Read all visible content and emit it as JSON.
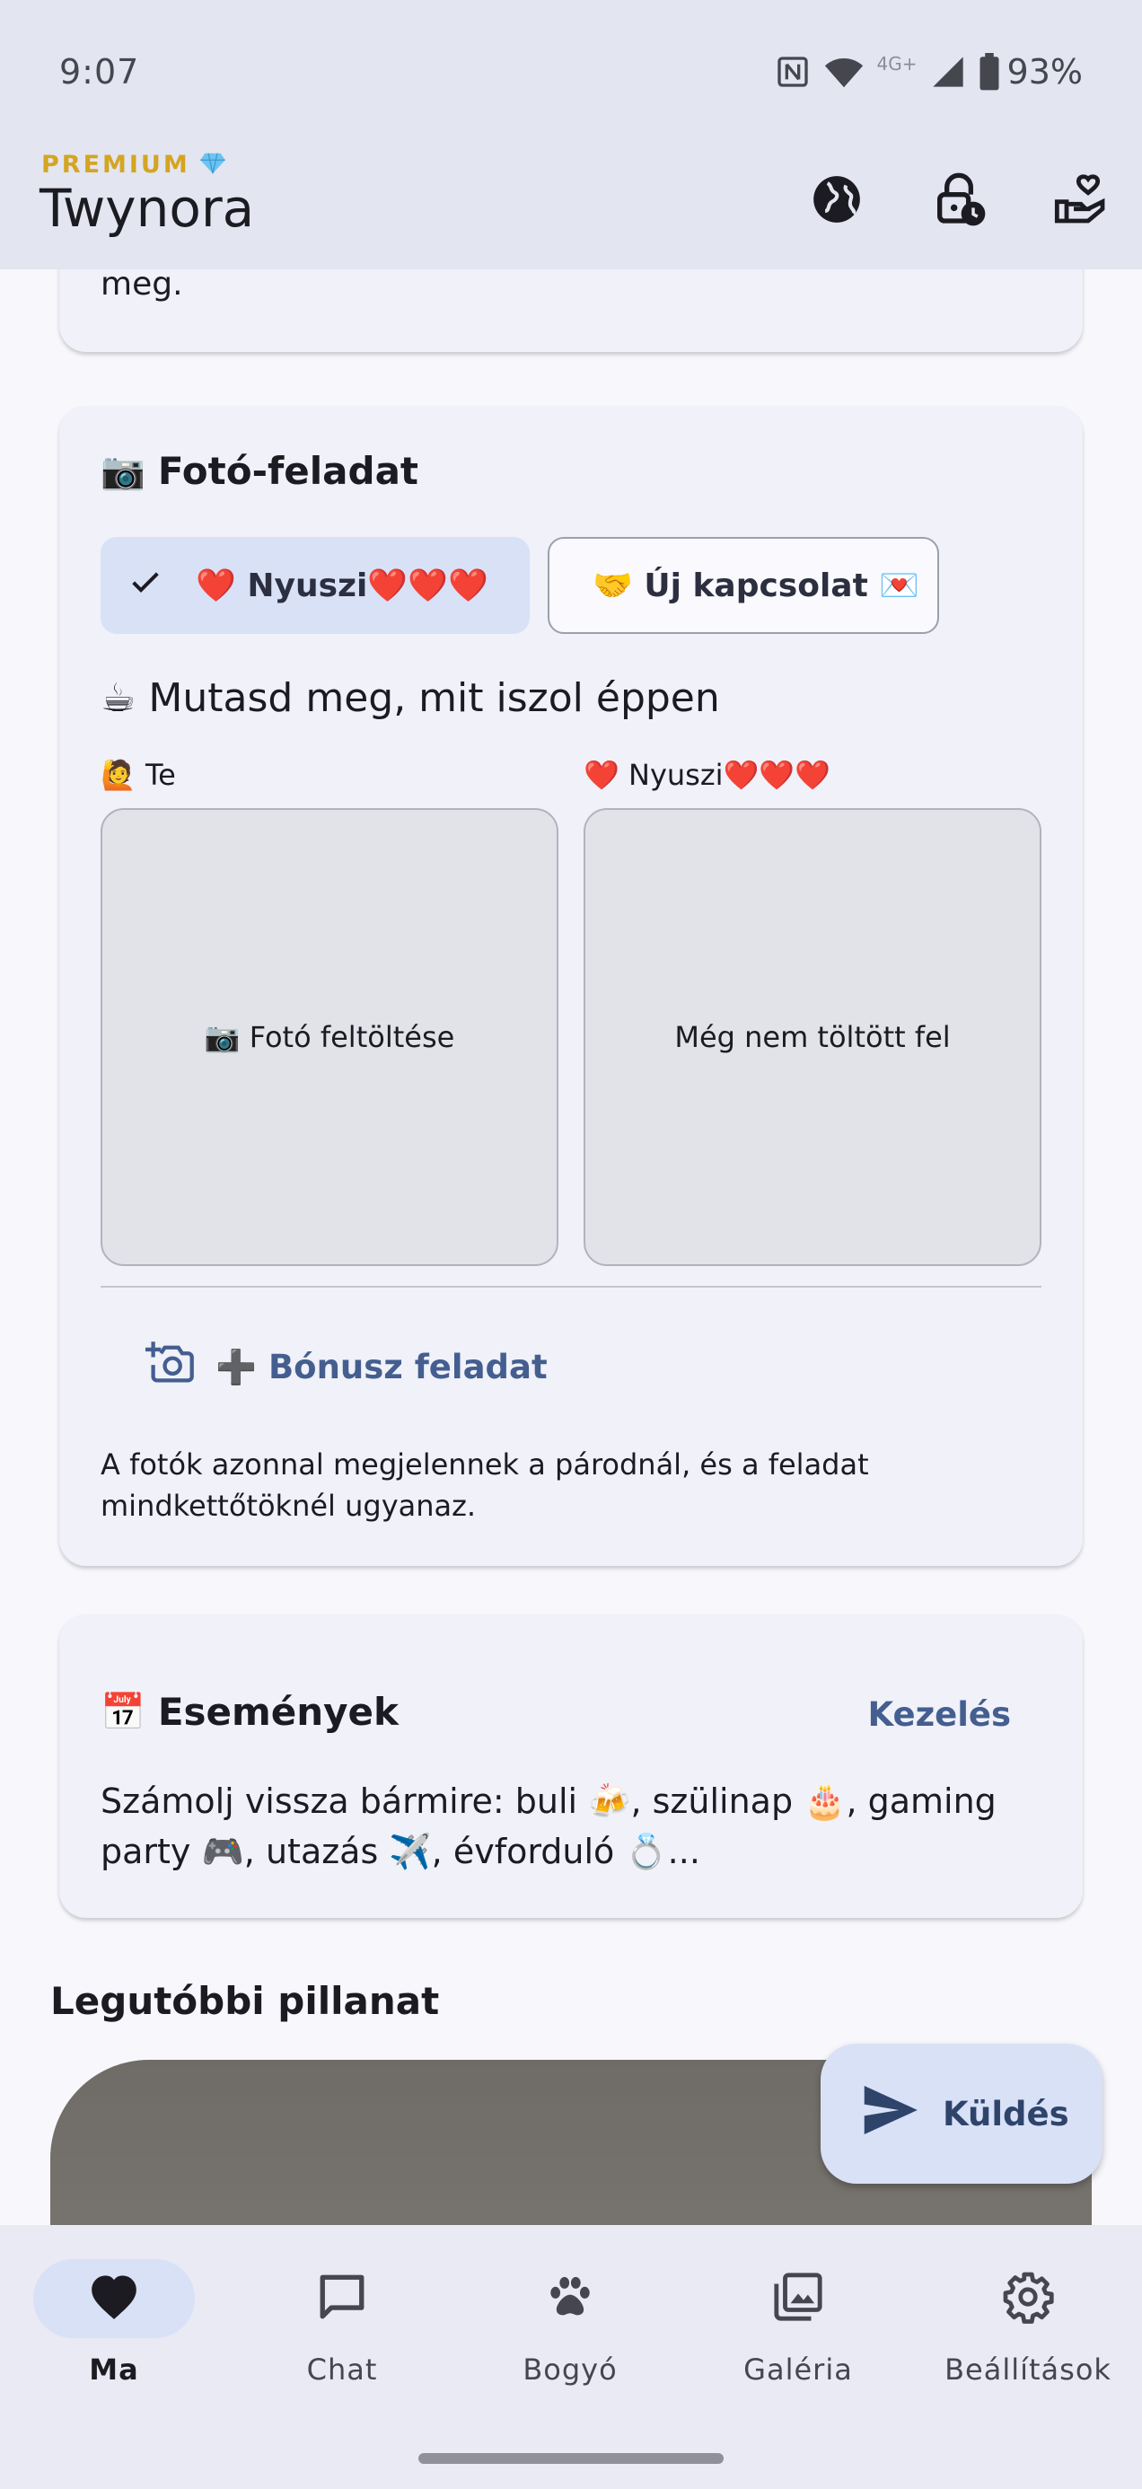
{
  "status_bar": {
    "time": "9:07",
    "network": "4G+",
    "battery": "93%"
  },
  "app_bar": {
    "premium_label": "PREMIUM",
    "premium_icon": "gem-icon",
    "title": "Twynora",
    "actions": [
      {
        "name": "globe-button",
        "icon": "globe-icon"
      },
      {
        "name": "lock-clock-button",
        "icon": "lock-clock-icon"
      },
      {
        "name": "heart-hand-button",
        "icon": "heart-hand-icon"
      }
    ]
  },
  "previous_card": {
    "tail_text": "meg."
  },
  "photo_task": {
    "title_emoji": "📷",
    "title": "Fotó-feladat",
    "chips": {
      "selected_label": "❤️ Nyuszi❤️❤️❤️",
      "other_label": "🤝 Új kapcsolat 💌"
    },
    "prompt": "☕ Mutasd meg, mit iszol éppen",
    "me_label": "🙋 Te",
    "partner_label": "❤️ Nyuszi❤️❤️❤️",
    "upload_text": "📷 Fotó feltöltése",
    "partner_status": "Még nem töltött fel",
    "bonus_label": "➕ Bónusz feladat",
    "footnote": "A fotók azonnal megjelennek a párodnál, és a feladat mindkettőtöknél ugyanaz."
  },
  "events": {
    "title_emoji": "📅",
    "title": "Események",
    "manage_label": "Kezelés",
    "description": "Számolj vissza bármire: buli 🍻, szülinap 🎂, gaming party 🎮, utazás ✈️, évforduló 💍..."
  },
  "recent": {
    "title": "Legutóbbi pillanat"
  },
  "fab": {
    "label": "Küldés",
    "icon": "send-icon"
  },
  "bottom_nav": {
    "items": [
      {
        "label": "Ma",
        "icon": "heart-icon",
        "active": true
      },
      {
        "label": "Chat",
        "icon": "chat-icon",
        "active": false
      },
      {
        "label": "Bogyó",
        "icon": "paw-icon",
        "active": false
      },
      {
        "label": "Galéria",
        "icon": "gallery-icon",
        "active": false
      },
      {
        "label": "Beállítások",
        "icon": "gear-icon",
        "active": false
      }
    ]
  },
  "colors": {
    "accent": "#445e8f",
    "premium": "#d4a521",
    "chip_selected": "#d9e1f7",
    "card": "#f0f1f9",
    "background": "#f7f7fc"
  }
}
